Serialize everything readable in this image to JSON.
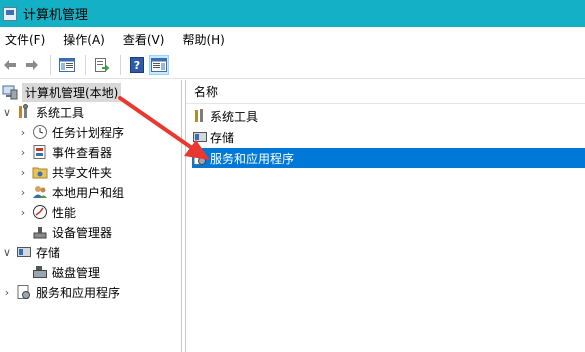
{
  "window": {
    "title": "计算机管理"
  },
  "menu": [
    "文件(F)",
    "操作(A)",
    "查看(V)",
    "帮助(H)"
  ],
  "toolbar": {
    "buttons": [
      "back-arrow-icon",
      "forward-arrow-icon",
      "show-hide-console-tree-icon",
      "export-list-icon",
      "help-icon",
      "show-hide-action-pane-icon"
    ]
  },
  "tree": {
    "root": "计算机管理(本地)",
    "system_tools": "系统工具",
    "task_scheduler": "任务计划程序",
    "event_viewer": "事件查看器",
    "shared_folders": "共享文件夹",
    "local_users": "本地用户和组",
    "performance": "性能",
    "device_manager": "设备管理器",
    "storage": "存储",
    "disk_management": "磁盘管理",
    "services_apps": "服务和应用程序"
  },
  "list": {
    "header": "名称",
    "items": [
      "系统工具",
      "存储",
      "服务和应用程序"
    ],
    "selected_index": 2
  },
  "colors": {
    "titlebar": "#14b1c6",
    "selection": "#0078d7",
    "annotation_arrow": "#e8382f"
  }
}
